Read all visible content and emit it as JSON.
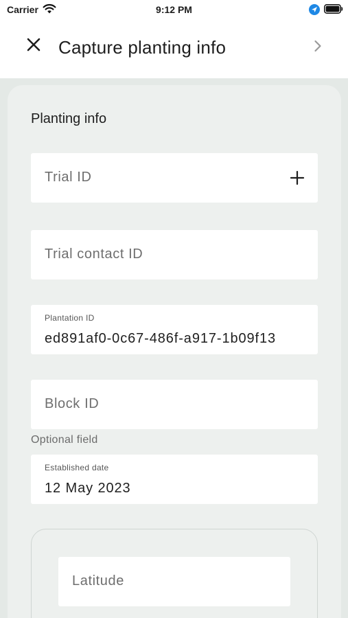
{
  "status_bar": {
    "carrier": "Carrier",
    "time": "9:12 PM"
  },
  "header": {
    "title": "Capture planting info",
    "close_icon": "close-icon",
    "next_icon": "chevron-right-icon"
  },
  "form": {
    "section_title": "Planting info",
    "trial_id": {
      "placeholder": "Trial ID"
    },
    "trial_contact_id": {
      "placeholder": "Trial contact ID"
    },
    "plantation_id": {
      "label": "Plantation ID",
      "value": "ed891af0-0c67-486f-a917-1b09f13"
    },
    "block_id": {
      "placeholder": "Block ID",
      "helper": "Optional field"
    },
    "established_date": {
      "label": "Established date",
      "value": "12 May 2023"
    },
    "latitude": {
      "placeholder": "Latitude"
    }
  },
  "colors": {
    "background": "#e4e9e6",
    "card": "#edf0ee",
    "field": "#ffffff",
    "location_accent": "#1e88e5"
  }
}
